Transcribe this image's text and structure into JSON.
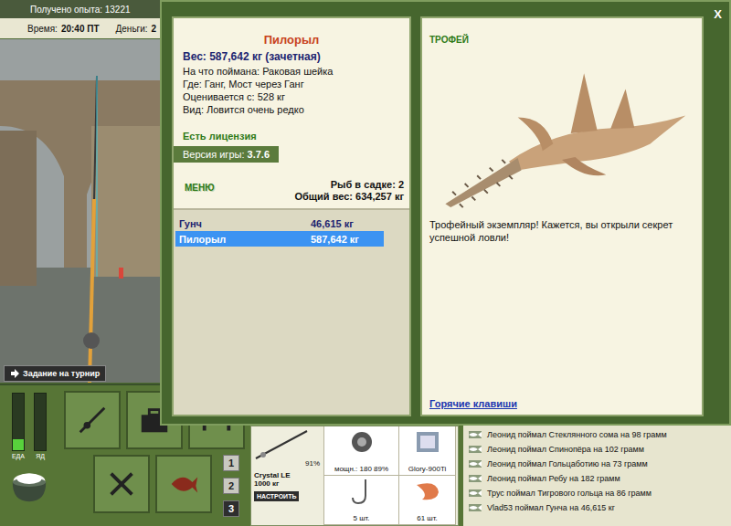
{
  "hud": {
    "experience": "Получено опыта: 13221",
    "time_label": "Время:",
    "time": "20:40 ПТ",
    "money_label": "Деньги:",
    "money": "2"
  },
  "tournament_button": "Задание на турнир",
  "needs": [
    {
      "label": "ЕДА",
      "level": 0.2
    },
    {
      "label": "ЯД",
      "level": 0
    }
  ],
  "quick_tabs": [
    {
      "label": "1",
      "selected": false
    },
    {
      "label": "2",
      "selected": false
    },
    {
      "label": "3",
      "selected": true
    }
  ],
  "tackle": {
    "rod": {
      "name": "Crystal LE",
      "test": "1000 кг",
      "condition": "91%"
    },
    "reel": {
      "power": "мощн.: 180",
      "condition": "89%"
    },
    "line": {
      "name": "Glory-900Ti"
    },
    "hook": {
      "count": "5 шт."
    },
    "bait": {
      "count": "61 шт."
    },
    "setup_button": "НАСТРОИТЬ"
  },
  "log": [
    "Леонид поймал Стеклянного сома на 98 грамм",
    "Леонид поймал Спинопёра на 102 грамм",
    "Леонид поймал Гольцаботию на 73 грамм",
    "Леонид поймал Ребу на 182 грамм",
    "Трус поймал Тигрового гольца на 86 грамм",
    "Vlad53 поймал Гунча на 46,615 кг"
  ],
  "dialog": {
    "close": "X",
    "fish": {
      "name": "Пилорыл",
      "weight": "Вес: 587,642 кг (зачетная)",
      "details": [
        "На что поймана: Раковая шейка",
        "Где: Ганг, Мост через Ганг",
        "Оценивается с: 528 кг",
        "Вид: Ловится очень редко"
      ]
    },
    "license": "Есть лицензия",
    "version_label": "Версия игры:",
    "version": "3.7.6",
    "menu": "МЕНЮ",
    "keepnet_count": "Рыб в садке: 2",
    "total_weight": "Общий вес: 634,257 кг",
    "catches": [
      {
        "name": "Гунч",
        "weight": "46,615 кг",
        "selected": false
      },
      {
        "name": "Пилорыл",
        "weight": "587,642 кг",
        "selected": true
      }
    ],
    "trophy_label": "ТРОФЕЙ",
    "trophy_text": "Трофейный экземпляр! Кажется, вы открыли секрет успешной ловли!",
    "hotkeys": "Горячие клавиши"
  }
}
